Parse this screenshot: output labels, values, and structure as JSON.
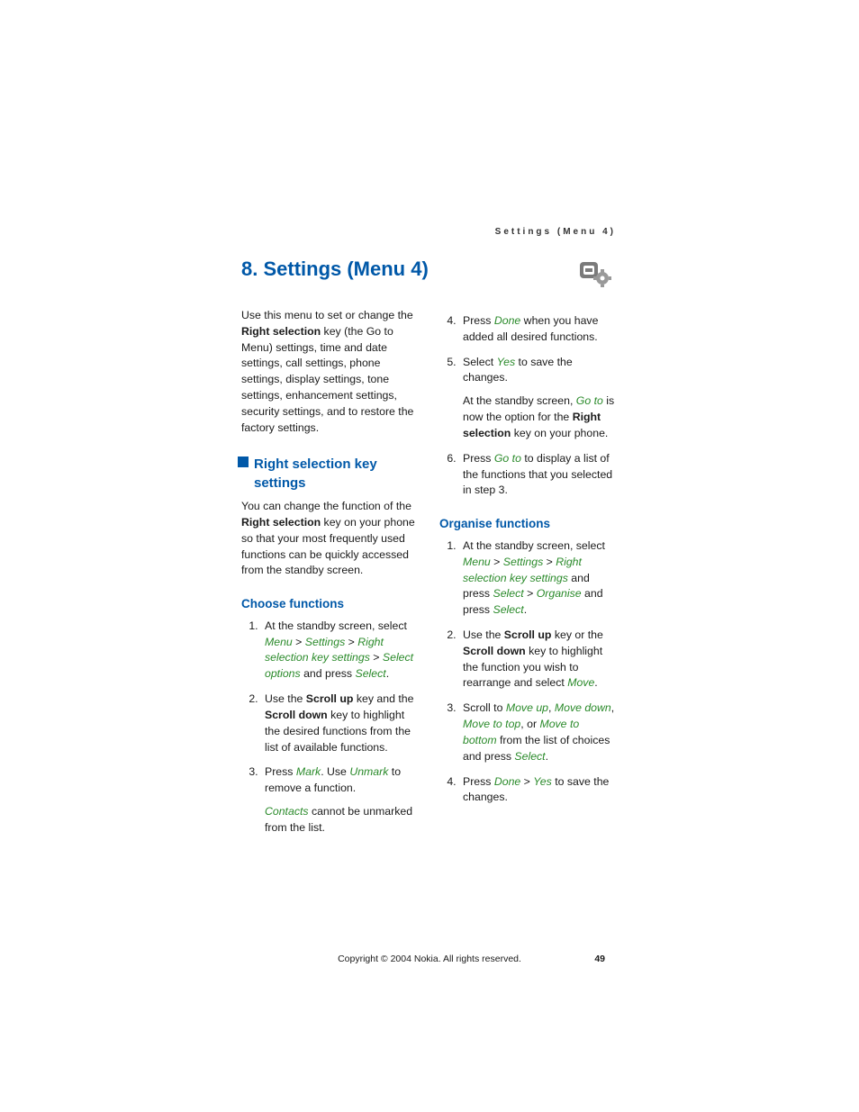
{
  "running_head": "Settings (Menu 4)",
  "chapter_title": "8. Settings (Menu 4)",
  "intro": {
    "pre": "Use this menu to set or change the ",
    "bold": "Right selection",
    "post": " key (the Go to Menu) settings, time and date settings, call settings, phone settings, display settings, tone settings, enhancement settings, security settings, and to restore the factory settings."
  },
  "section_h2": "Right selection key settings",
  "section_h2_body": {
    "pre": "You can change the function of the ",
    "bold": "Right selection",
    "post": " key on your phone so that your most frequently used functions can be quickly accessed from the standby screen."
  },
  "choose_h3": "Choose functions",
  "choose_steps": {
    "s1": {
      "pre": "At the standby screen, select ",
      "menu": "Menu",
      "gt1": " > ",
      "settings": "Settings",
      "gt2": " > ",
      "rsks": "Right selection key settings",
      "gt3": " > ",
      "selopt": "Select options",
      "mid": " and press ",
      "select": "Select",
      "end": "."
    },
    "s2": {
      "pre": "Use the ",
      "b1": "Scroll up",
      "mid1": " key and the ",
      "b2": "Scroll down",
      "post": " key to highlight the desired functions from the list of available functions."
    },
    "s3": {
      "pre": "Press ",
      "mark": "Mark",
      "mid": ". Use ",
      "unmark": "Unmark",
      "post": " to remove a function.",
      "sub_pre": "",
      "contacts": "Contacts",
      "sub_post": " cannot be unmarked from the list."
    },
    "s4": {
      "pre": "Press ",
      "done": "Done",
      "post": " when you have added all desired functions."
    },
    "s5": {
      "pre": "Select ",
      "yes": "Yes",
      "post": " to save the changes.",
      "sub_pre": "At the standby screen, ",
      "goto": "Go to",
      "sub_mid": " is now the option for the ",
      "b": "Right selection",
      "sub_post": " key on your phone."
    },
    "s6": {
      "pre": "Press ",
      "goto": "Go to",
      "post": " to display a list of the functions that you selected in step 3."
    }
  },
  "organise_h3": "Organise functions",
  "organise_steps": {
    "s1": {
      "pre": "At the standby screen, select ",
      "menu": "Menu",
      "gt1": " > ",
      "settings": "Settings",
      "gt2": " > ",
      "rsks": "Right selection key settings",
      "mid1": " and press ",
      "select1": "Select",
      "gt3": " > ",
      "organise": "Organise",
      "mid2": " and press ",
      "select2": "Select",
      "end": "."
    },
    "s2": {
      "pre": "Use the ",
      "b1": "Scroll up",
      "mid1": " key or the ",
      "b2": "Scroll down",
      "mid2": " key to highlight the function you wish to rearrange and select ",
      "move": "Move",
      "end": "."
    },
    "s3": {
      "pre": "Scroll to ",
      "mu": "Move up",
      "c1": ", ",
      "md": "Move down",
      "c2": ", ",
      "mt": "Move to top",
      "c3": ", or ",
      "mb": "Move to bottom",
      "mid": " from the list of choices and press ",
      "select": "Select",
      "end": "."
    },
    "s4": {
      "pre": "Press ",
      "done": "Done",
      "gt": " > ",
      "yes": "Yes",
      "post": " to save the changes."
    }
  },
  "footer": {
    "copyright": "Copyright © 2004 Nokia. All rights reserved.",
    "page": "49"
  }
}
